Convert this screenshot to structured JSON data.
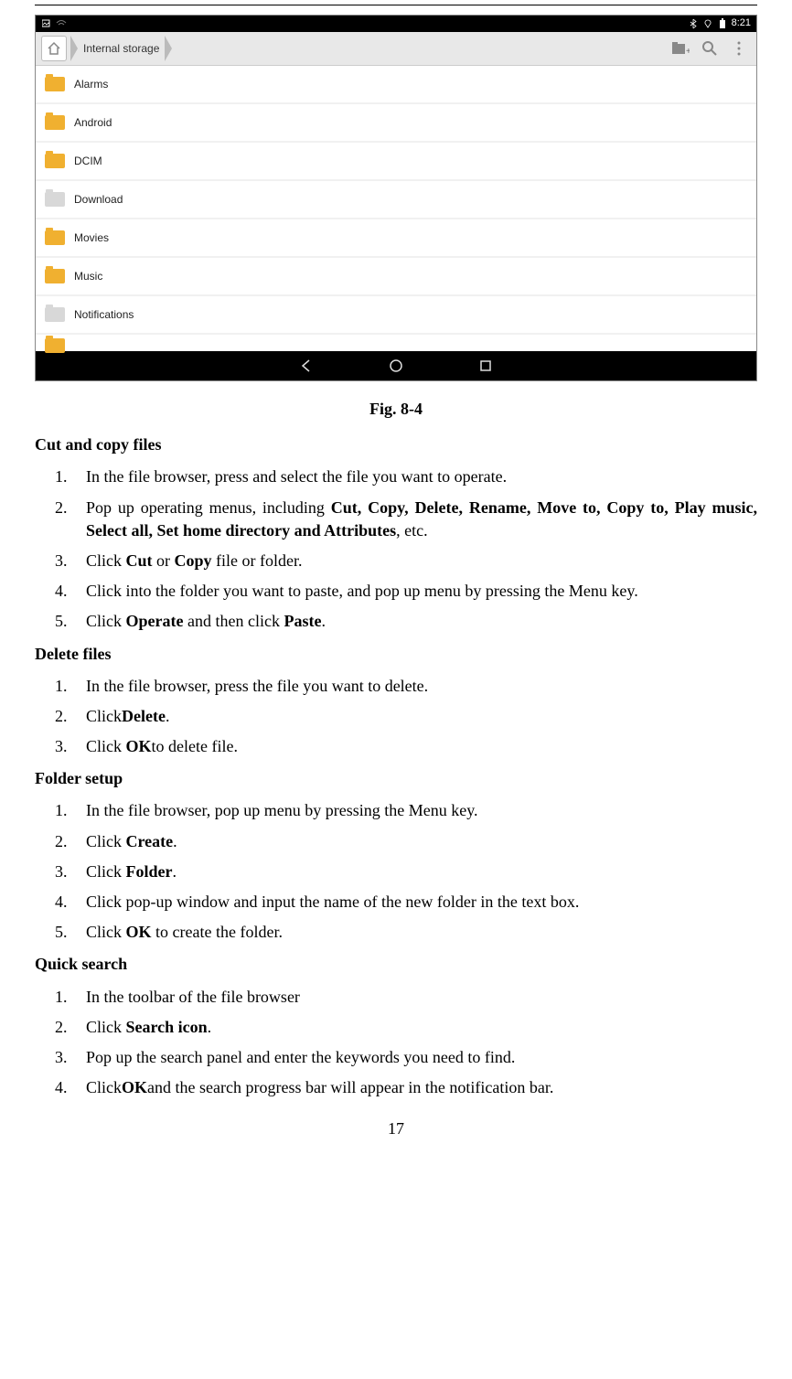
{
  "statusBar": {
    "time": "8:21"
  },
  "breadcrumb": {
    "label": "Internal storage"
  },
  "folders": [
    "Alarms",
    "Android",
    "DCIM",
    "Download",
    "Movies",
    "Music",
    "Notifications"
  ],
  "caption": "Fig. 8-4",
  "section1": {
    "title": "Cut and copy files",
    "items": [
      {
        "pre": "In the file browser, press and select the file you want to operate."
      },
      {
        "pre": "Pop up operating menus, including ",
        "bold": "Cut, Copy, Delete, Rename, Move to, Copy to, Play music, Select all, Set home directory and Attributes",
        "post": ", etc."
      },
      {
        "pre": "Click ",
        "bold": "Cut",
        "post": " or ",
        "bold2": "Copy",
        "post2": " file or folder."
      },
      {
        "pre": "Click into the folder you want to paste, and pop up menu by pressing the Menu key."
      },
      {
        "pre": "Click ",
        "bold": "Operate",
        "post": " and then click ",
        "bold2": "Paste",
        "post2": "."
      }
    ]
  },
  "section2": {
    "title": "Delete files",
    "items": [
      {
        "pre": "In the file browser, press the file you want to delete."
      },
      {
        "pre": "Click",
        "bold": "Delete",
        "post": "."
      },
      {
        "pre": "Click ",
        "bold": "OK",
        "post": "to delete file."
      }
    ]
  },
  "section3": {
    "title": "Folder setup",
    "items": [
      {
        "pre": "In the file browser, pop up menu by pressing the Menu key."
      },
      {
        "pre": "Click ",
        "bold": "Create",
        "post": "."
      },
      {
        "pre": "Click ",
        "bold": "Folder",
        "post": "."
      },
      {
        "pre": "Click pop-up window and input the name of the new folder in the text box."
      },
      {
        "pre": "Click ",
        "bold": "OK",
        "post": " to create the folder."
      }
    ]
  },
  "section4": {
    "title": "Quick search",
    "items": [
      {
        "pre": "In the toolbar of the file browser"
      },
      {
        "pre": "Click ",
        "bold": "Search icon",
        "post": "."
      },
      {
        "pre": "Pop up the search panel and enter the keywords you need to find."
      },
      {
        "pre": "Click",
        "bold": "OK",
        "post": "and the search progress bar will appear in the notification bar."
      }
    ]
  },
  "pageNumber": "17"
}
